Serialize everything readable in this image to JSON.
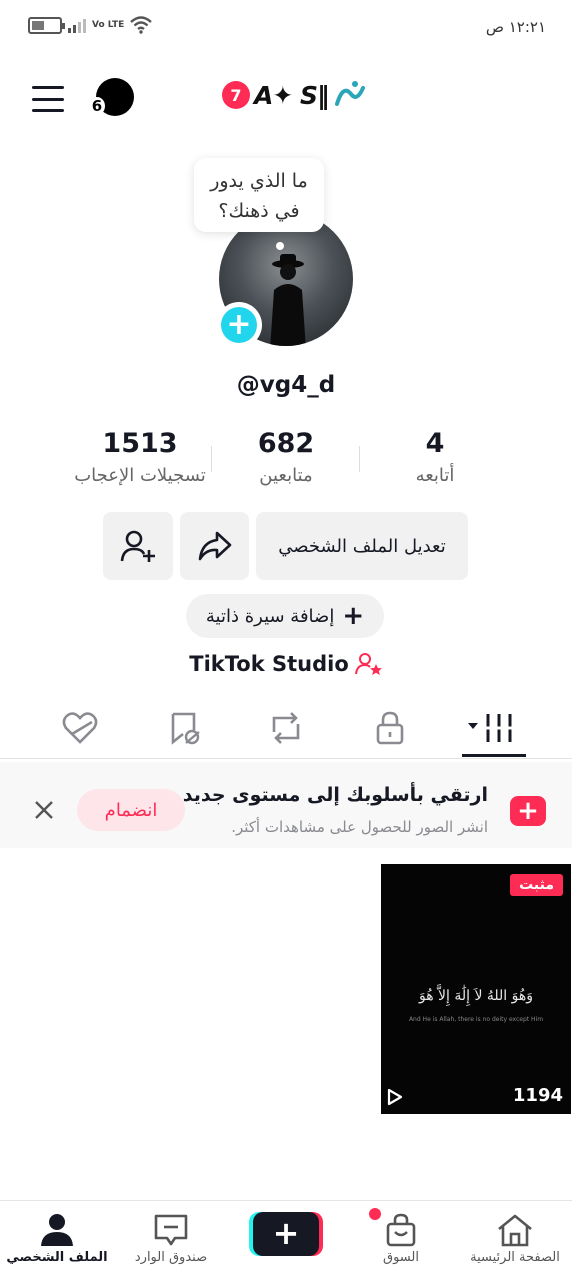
{
  "status_bar": {
    "time": "١٢:٢١ ص",
    "network_label": "Vo LTE",
    "icons": [
      "battery-icon",
      "signal-icon",
      "wifi-icon"
    ]
  },
  "header": {
    "notification_count": "7",
    "username_display": "A✦ S‖",
    "friends_count": "6"
  },
  "profile": {
    "bubble_text_line1": "ما الذي يدور",
    "bubble_text_line2": "في ذهنك؟",
    "handle": "@vg4_d"
  },
  "stats": {
    "following": {
      "value": "4",
      "label": "أتابعه"
    },
    "followers": {
      "value": "682",
      "label": "متابعين"
    },
    "likes": {
      "value": "1513",
      "label": "تسجيلات الإعجاب"
    }
  },
  "actions": {
    "edit_profile": "تعديل الملف الشخصي",
    "add_bio": "إضافة سيرة ذاتية",
    "studio": "TikTok Studio"
  },
  "promo": {
    "title": "ارتقي بأسلوبك إلى مستوى جديد",
    "subtitle": "انشر الصور للحصول على مشاهدات أكثر.",
    "join": "انضمام"
  },
  "videos": [
    {
      "pinned_label": "مثبت",
      "text": "وَهُوَ اللهُ لاَ إِلَٰهَ إِلاَّ هُوَ",
      "subtext": "And He is Allah, there is no deity except Him",
      "views": "1194"
    }
  ],
  "nav": {
    "home": "الصفحة الرئيسية",
    "shop": "السوق",
    "inbox": "صندوق الوارد",
    "profile": "الملف الشخصي",
    "create": "+"
  },
  "colors": {
    "accent": "#fe2c55",
    "cyan": "#20d5ec",
    "text": "#161823"
  }
}
